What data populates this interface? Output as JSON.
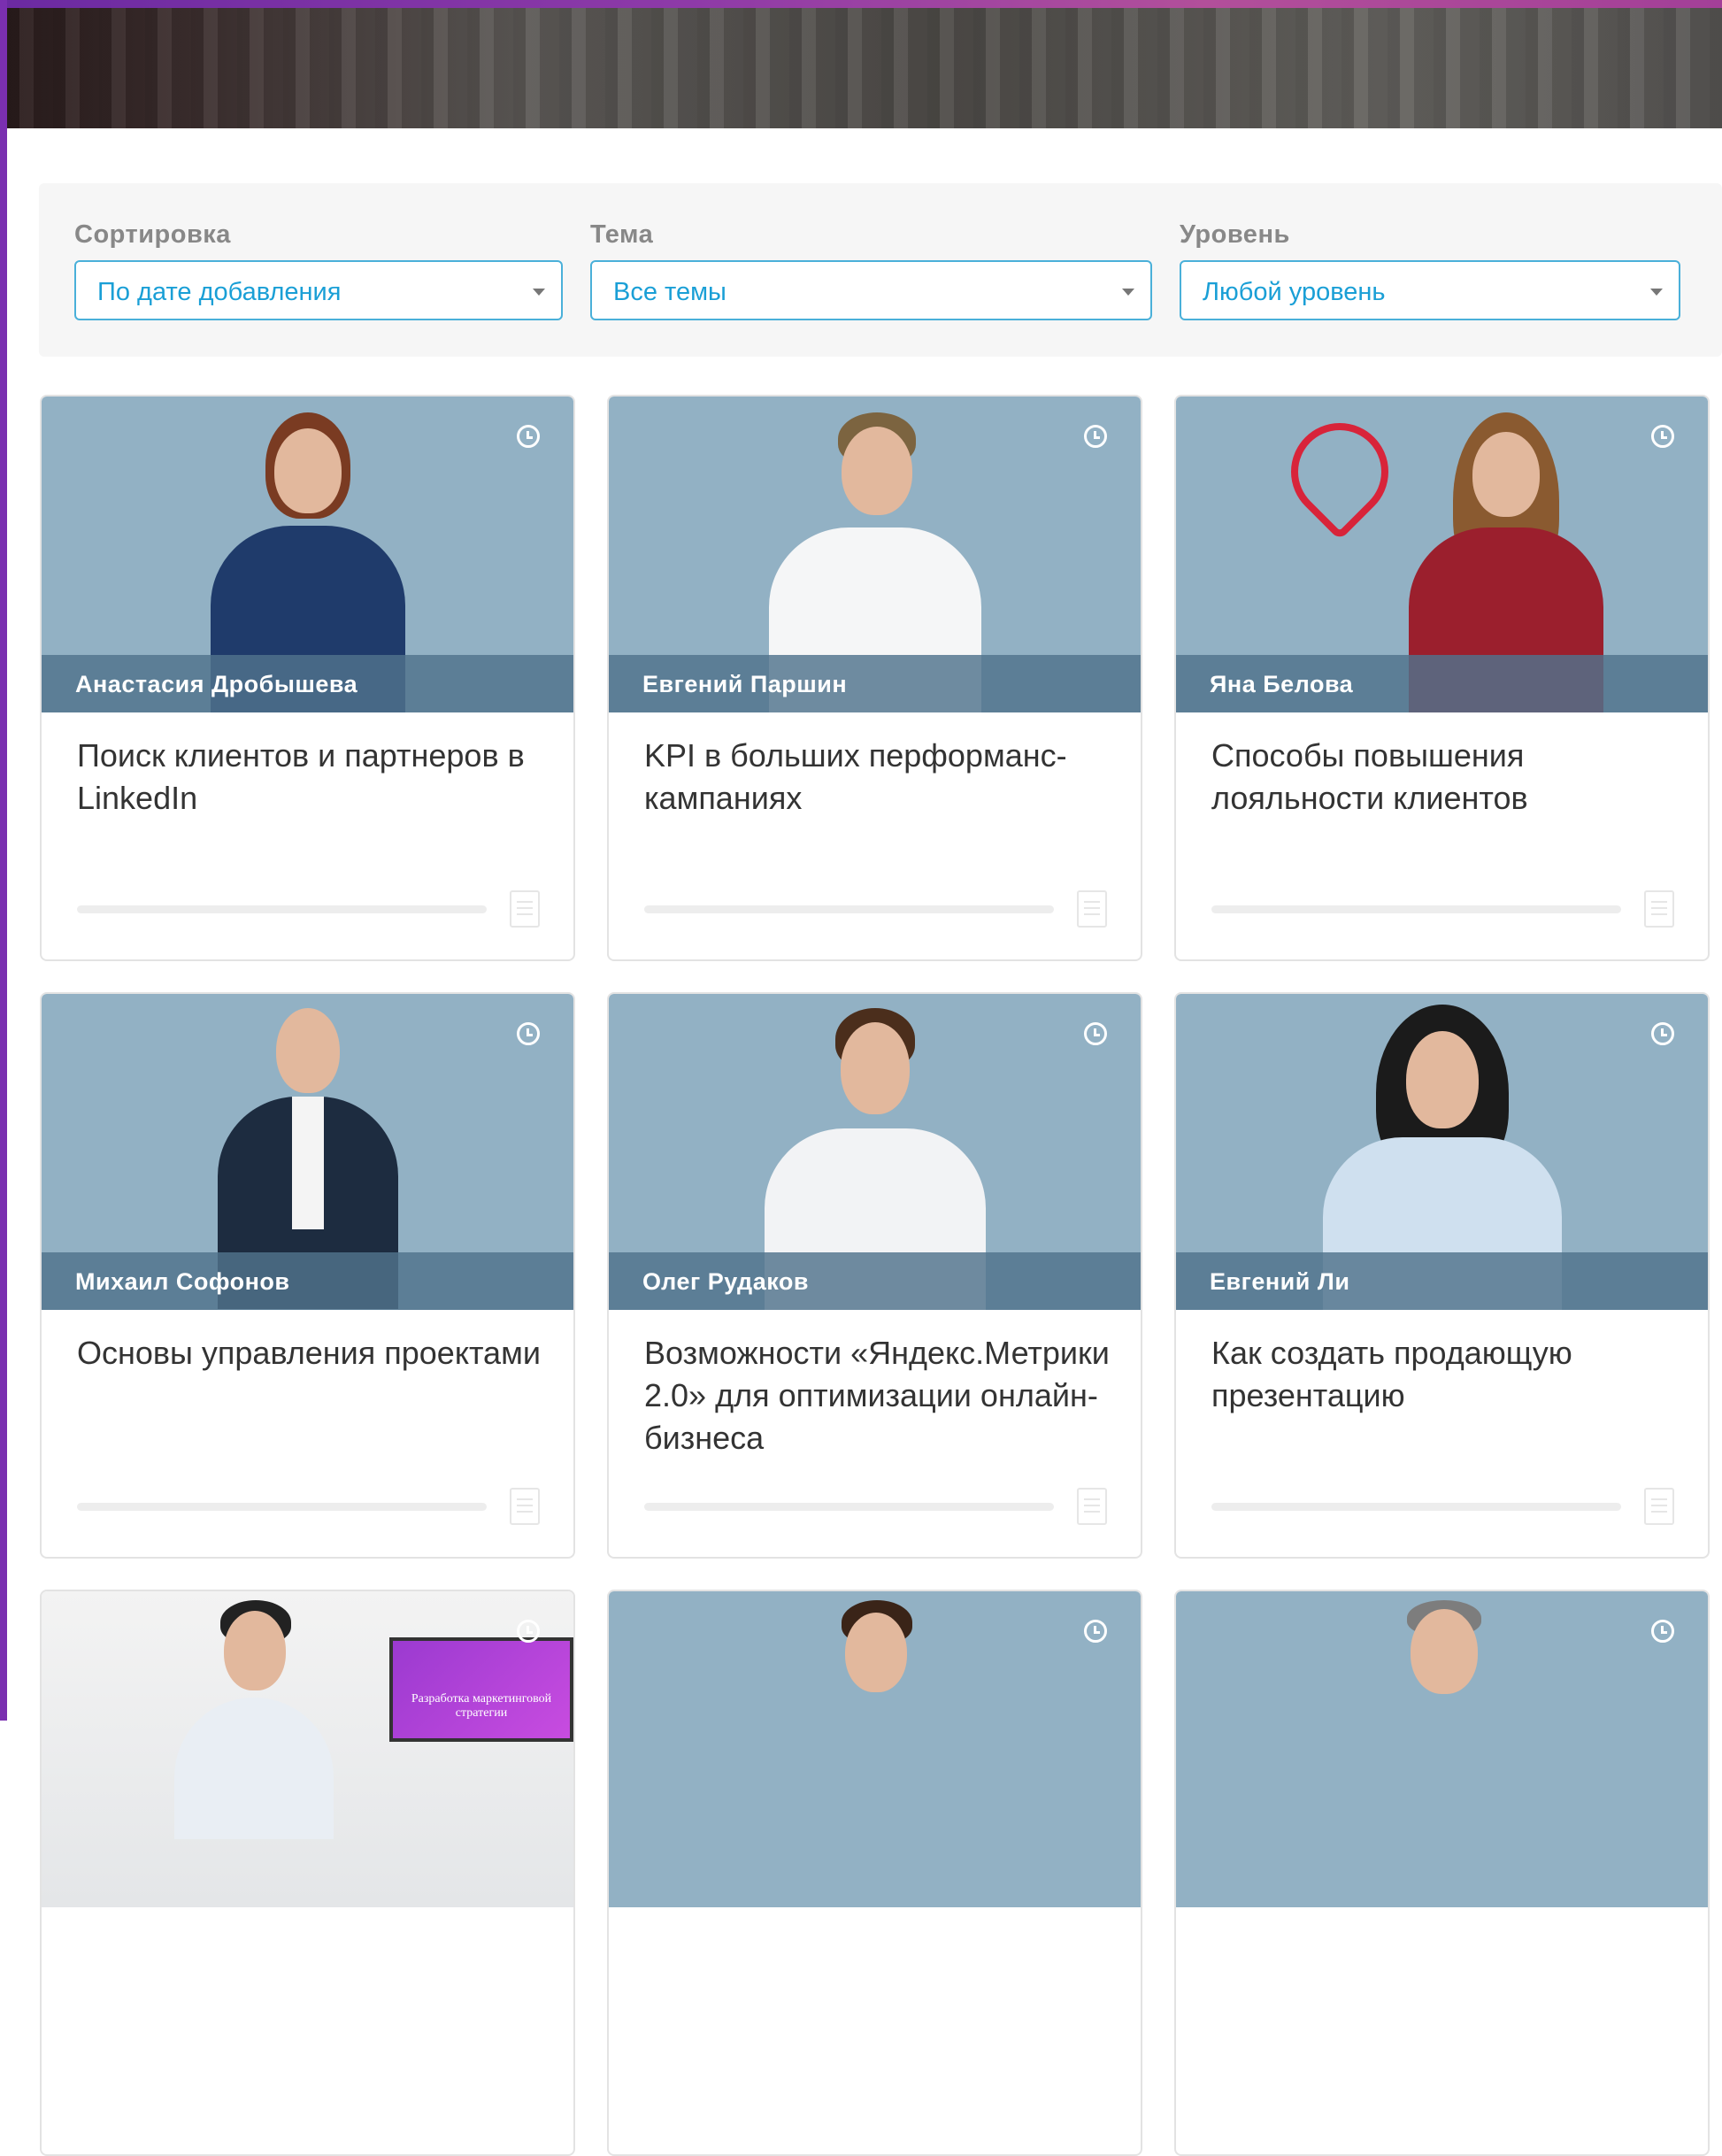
{
  "filters": {
    "sort": {
      "label": "Сортировка",
      "value": "По дате добавления"
    },
    "topic": {
      "label": "Тема",
      "value": "Все темы"
    },
    "level": {
      "label": "Уровень",
      "value": "Любой уровень"
    }
  },
  "cards": [
    {
      "author": "Анастасия Дробышева",
      "title": "Поиск клиентов и партнеров в LinkedIn"
    },
    {
      "author": "Евгений Паршин",
      "title": "KPI в больших перформанс-кампаниях"
    },
    {
      "author": "Яна Белова",
      "title": "Способы повышения лояльности клиентов"
    },
    {
      "author": "Михаил Софонов",
      "title": "Основы управления проектами"
    },
    {
      "author": "Олег Рудаков",
      "title": "Возможности «Яндекс.Метрики 2.0» для оптимизации онлайн-бизнеса"
    },
    {
      "author": "Евгений Ли",
      "title": "Как создать продающую презентацию"
    },
    {
      "author": "",
      "title": "",
      "screen_text": "Разработка маркетинговой стратегии"
    },
    {
      "author": "",
      "title": ""
    },
    {
      "author": "",
      "title": ""
    }
  ],
  "colors": {
    "accent": "#1a9fd6",
    "card_photo_bg": "#92b1c4",
    "frame": "#7a2fb0"
  }
}
